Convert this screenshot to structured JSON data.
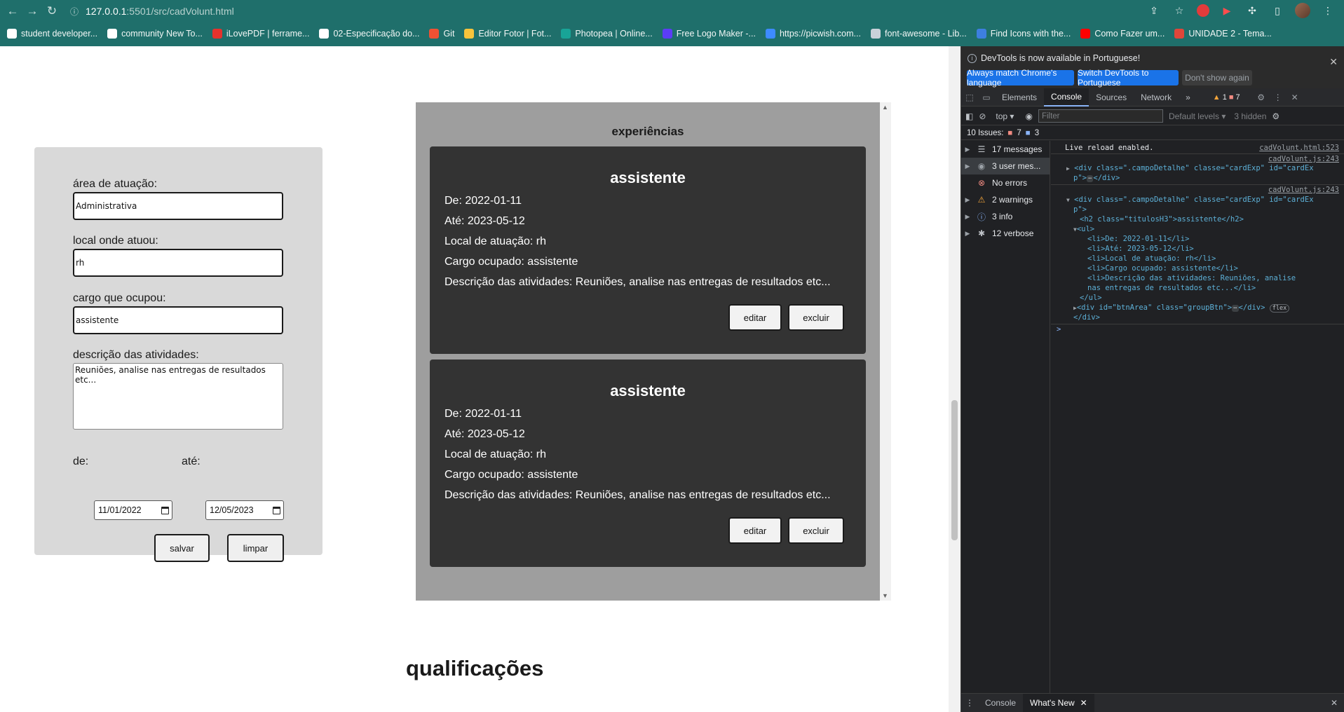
{
  "browser": {
    "url_host": "127.0.0.1",
    "url_rest": ":5501/src/cadVolunt.html",
    "bookmarks": [
      {
        "label": "student developer...",
        "color": "#ffffff"
      },
      {
        "label": "community New To...",
        "color": "#ffffff"
      },
      {
        "label": "iLovePDF | ferrame...",
        "color": "#e5322d"
      },
      {
        "label": "02-Especificação do...",
        "color": "#ffffff"
      },
      {
        "label": "Git",
        "color": "#f05133"
      },
      {
        "label": "Editor Fotor | Fot...",
        "color": "#f7c33b"
      },
      {
        "label": "Photopea | Online...",
        "color": "#18a497"
      },
      {
        "label": "Free Logo Maker -...",
        "color": "#5b3df5"
      },
      {
        "label": "https://picwish.com...",
        "color": "#3d8bff"
      },
      {
        "label": "font-awesome - Lib...",
        "color": "#c9d1d9"
      },
      {
        "label": "Find Icons with the...",
        "color": "#3d7fe0"
      },
      {
        "label": "Como Fazer um...",
        "color": "#ff0000"
      },
      {
        "label": "UNIDADE 2 - Tema...",
        "color": "#e0463a"
      }
    ]
  },
  "form": {
    "area_label": "área de atuação:",
    "area_value": "Administrativa",
    "local_label": "local onde atuou:",
    "local_value": "rh",
    "cargo_label": "cargo que ocupou:",
    "cargo_value": "assistente",
    "descricao_label": "descrição das atividades:",
    "descricao_value": "Reuniões, analise nas entregas de resultados etc...",
    "de_label": "de:",
    "de_value": "11/01/2022",
    "ate_label": "até:",
    "ate_value": "12/05/2023",
    "salvar": "salvar",
    "limpar": "limpar"
  },
  "experiences": {
    "title": "experiências",
    "cards": [
      {
        "title": "assistente",
        "de": "De: 2022-01-11",
        "ate": "Até: 2023-05-12",
        "local": "Local de atuação: rh",
        "cargo": "Cargo ocupado: assistente",
        "descricao": "Descrição das atividades: Reuniões, analise nas entregas de resultados etc...",
        "edit": "editar",
        "delete": "excluir"
      },
      {
        "title": "assistente",
        "de": "De: 2022-01-11",
        "ate": "Até: 2023-05-12",
        "local": "Local de atuação: rh",
        "cargo": "Cargo ocupado: assistente",
        "descricao": "Descrição das atividades: Reuniões, analise nas entregas de resultados etc...",
        "edit": "editar",
        "delete": "excluir"
      }
    ]
  },
  "qualifications_title": "qualificações",
  "devtools": {
    "notice": "DevTools is now available in Portuguese!",
    "btn_match": "Always match Chrome's language",
    "btn_switch": "Switch DevTools to Portuguese",
    "btn_dont": "Don't show again",
    "tabs": [
      "Elements",
      "Console",
      "Sources",
      "Network"
    ],
    "more_tabs": "»",
    "warn_count": "1",
    "err_count": "7",
    "context": "top",
    "filter_placeholder": "Filter",
    "levels": "Default levels",
    "hidden": "3 hidden",
    "issues_label": "10 Issues:",
    "issues_err": "7",
    "issues_info": "3",
    "sidebar": [
      {
        "icon": "list-icon",
        "glyph": "☰",
        "label": "17 messages",
        "color": "#bdc1c6"
      },
      {
        "icon": "user-icon",
        "glyph": "◉",
        "label": "3 user mes...",
        "color": "#9aa0a6"
      },
      {
        "icon": "error-icon",
        "glyph": "⊗",
        "label": "No errors",
        "color": "#f28b82"
      },
      {
        "icon": "warning-icon",
        "glyph": "⚠",
        "label": "2 warnings",
        "color": "#f2a43a"
      },
      {
        "icon": "info-icon",
        "glyph": "ⓘ",
        "label": "3 info",
        "color": "#8ab4f8"
      },
      {
        "icon": "bug-icon",
        "glyph": "✱",
        "label": "12 verbose",
        "color": "#bdc1c6"
      }
    ],
    "console": {
      "live_reload": "Live reload enabled.",
      "src1": "cadVolunt.html:523",
      "src2": "cadVolunt.js:243",
      "src3": "cadVolunt.js:243",
      "line1a": "<div class=\".campoDetalhe\" classe=\"cardExp\" id=\"cardEx",
      "line1b": "p\">",
      "line1c": "</div>",
      "line2a": "<div class=\".campoDetalhe\" classe=\"cardExp\" id=\"cardEx",
      "line2b": "p\">",
      "h2": "<h2 class=\"titulosH3\">assistente</h2>",
      "ul_open": "<ul>",
      "li1": "<li>De: 2022-01-11</li>",
      "li2": "<li>Até: 2023-05-12</li>",
      "li3": "<li>Local de atuação: rh</li>",
      "li4": "<li>Cargo ocupado: assistente</li>",
      "li5a": "<li>Descrição das atividades: Reuniões, analise",
      "li5b": "nas entregas de resultados etc...</li>",
      "ul_close": "</ul>",
      "btnarea": "<div id=\"btnArea\" class=\"groupBtn\">",
      "btnarea_close": "</div>",
      "flex": "flex",
      "div_close": "</div>",
      "prompt": ">"
    },
    "drawer_tabs": [
      "Console",
      "What's New"
    ]
  }
}
